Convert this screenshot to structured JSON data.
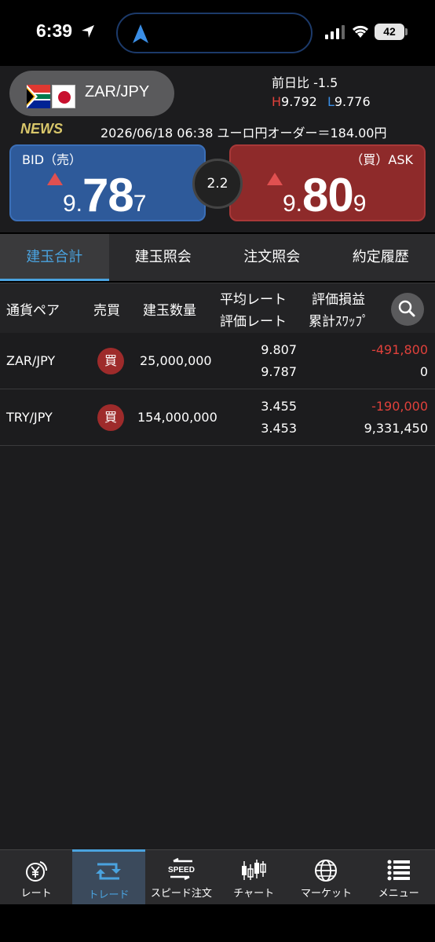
{
  "status": {
    "time": "6:39",
    "battery": "42"
  },
  "header": {
    "pair": "ZAR/JPY",
    "change_label": "前日比",
    "change_value": "-1.5",
    "high_label": "H",
    "high_value": "9.792",
    "low_label": "L",
    "low_value": "9.776",
    "news_tag": "NEWS",
    "news_text": "2026/06/18 06:38 ユーロ円オーダー＝184.00円",
    "bid": {
      "label": "BID（売）",
      "small": "9.",
      "large": "78",
      "last": "7"
    },
    "ask": {
      "label": "（買）ASK",
      "small": "9.",
      "large": "80",
      "last": "9"
    },
    "spread": "2.2"
  },
  "tabs": [
    "建玉合計",
    "建玉照会",
    "注文照会",
    "約定履歴"
  ],
  "table": {
    "headers": {
      "pair": "通貨ペア",
      "side": "売買",
      "qty": "建玉数量",
      "rate1": "平均レート",
      "rate2": "評価レート",
      "pl1": "評価損益",
      "pl2": "累計ｽﾜｯﾌﾟ"
    },
    "rows": [
      {
        "pair": "ZAR/JPY",
        "side": "買",
        "qty": "25,000,000",
        "avg": "9.807",
        "eval": "9.787",
        "pl": "-491,800",
        "swap": "0"
      },
      {
        "pair": "TRY/JPY",
        "side": "買",
        "qty": "154,000,000",
        "avg": "3.455",
        "eval": "3.453",
        "pl": "-190,000",
        "swap": "9,331,450"
      }
    ]
  },
  "nav": [
    "レート",
    "トレード",
    "スピード注文",
    "チャート",
    "マーケット",
    "メニュー"
  ],
  "colors": {
    "accent": "#4aa3df",
    "bid": "#2e5a9a",
    "ask": "#8e2a2a",
    "negative": "#e0413b"
  }
}
